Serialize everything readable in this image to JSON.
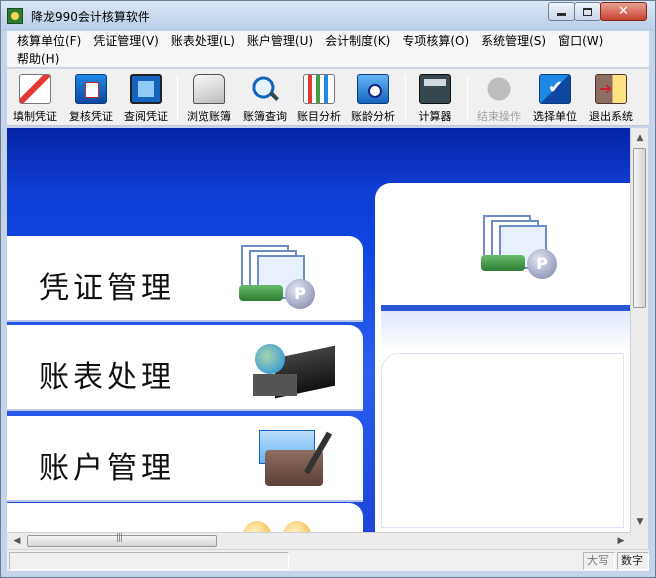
{
  "window": {
    "title": "降龙990会计核算软件",
    "controls": {
      "minimize": "_",
      "maximize": "□",
      "close": "✕"
    }
  },
  "menubar": {
    "items": [
      {
        "label": "核算单位(F)"
      },
      {
        "label": "凭证管理(V)"
      },
      {
        "label": "账表处理(L)"
      },
      {
        "label": "账户管理(U)"
      },
      {
        "label": "会计制度(K)"
      },
      {
        "label": "专项核算(O)"
      },
      {
        "label": "系统管理(S)"
      },
      {
        "label": "窗口(W)"
      },
      {
        "label": "帮助(H)"
      }
    ]
  },
  "toolbar": {
    "items": [
      {
        "label": "填制凭证",
        "icon": "fill-voucher-icon",
        "enabled": true
      },
      {
        "label": "复核凭证",
        "icon": "review-voucher-icon",
        "enabled": true
      },
      {
        "label": "查阅凭证",
        "icon": "view-voucher-icon",
        "enabled": true
      },
      {
        "label": "浏览账簿",
        "icon": "browse-ledger-icon",
        "enabled": true
      },
      {
        "label": "账簿查询",
        "icon": "ledger-query-icon",
        "enabled": true
      },
      {
        "label": "账目分析",
        "icon": "account-analysis-icon",
        "enabled": true
      },
      {
        "label": "账龄分析",
        "icon": "aging-analysis-icon",
        "enabled": true
      },
      {
        "label": "计算器",
        "icon": "calculator-icon",
        "enabled": true
      },
      {
        "label": "结束操作",
        "icon": "end-operation-icon",
        "enabled": false
      },
      {
        "label": "选择单位",
        "icon": "select-unit-icon",
        "enabled": true
      },
      {
        "label": "退出系统",
        "icon": "exit-system-icon",
        "enabled": true
      }
    ]
  },
  "modules": [
    {
      "label": "凭证管理",
      "icon": "voucher-management-icon"
    },
    {
      "label": "账表处理",
      "icon": "report-processing-icon"
    },
    {
      "label": "账户管理",
      "icon": "account-management-icon"
    }
  ],
  "scrollbars": {
    "hscroll_grip": "|||",
    "up": "▲",
    "down": "▼",
    "left": "◀",
    "right": "▶"
  },
  "statusbar": {
    "message": "",
    "caps": "大写",
    "num": "数字"
  },
  "colors": {
    "content_blue": "#0f46e0",
    "panel_band": "#2a57d8"
  }
}
